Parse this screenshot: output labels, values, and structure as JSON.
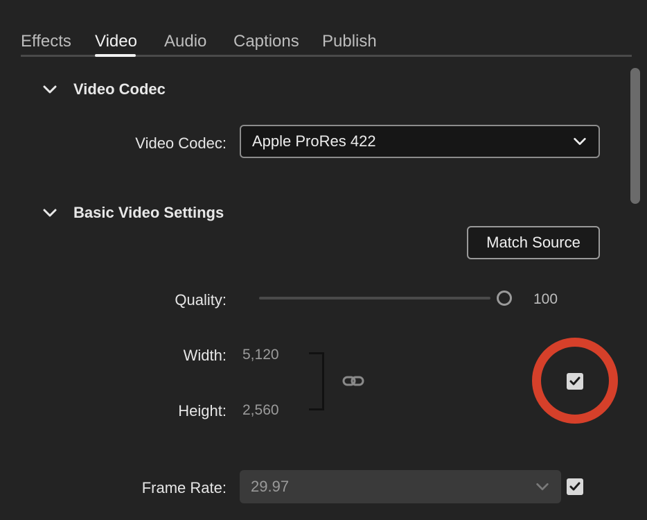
{
  "tabs": [
    {
      "label": "Effects",
      "active": false
    },
    {
      "label": "Video",
      "active": true
    },
    {
      "label": "Audio",
      "active": false
    },
    {
      "label": "Captions",
      "active": false
    },
    {
      "label": "Publish",
      "active": false
    }
  ],
  "video_codec_section": {
    "title": "Video Codec",
    "codec_label": "Video Codec:",
    "codec_value": "Apple ProRes 422"
  },
  "basic_video_section": {
    "title": "Basic Video Settings",
    "match_source_label": "Match Source",
    "quality_label": "Quality:",
    "quality_value": "100",
    "width_label": "Width:",
    "width_value": "5,120",
    "height_label": "Height:",
    "height_value": "2,560",
    "frame_rate_label": "Frame Rate:",
    "frame_rate_value": "29.97"
  },
  "icons": {
    "chevron": "chevron-down-icon",
    "link": "link-icon",
    "check": "checkmark-icon"
  },
  "colors": {
    "background": "#232323",
    "highlight_ring": "#d6402a",
    "checkbox": "#d9d9d9"
  }
}
